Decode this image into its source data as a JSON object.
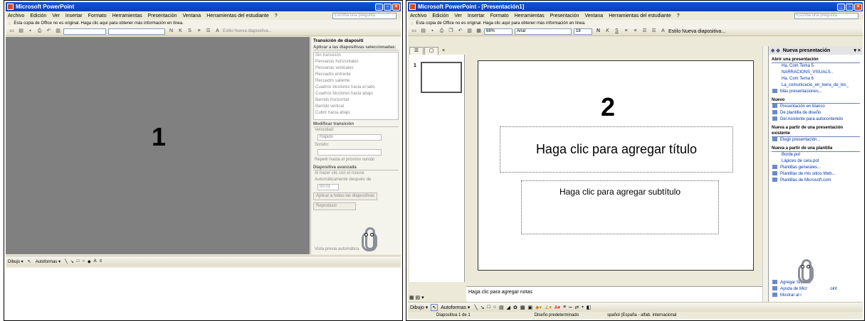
{
  "frame1": {
    "title": "Microsoft PowerPoint",
    "menus": [
      "Archivo",
      "Edición",
      "Ver",
      "Insertar",
      "Formato",
      "Herramientas",
      "Presentación",
      "Ventana",
      "Herramientas del estudiante",
      "?"
    ],
    "ask_placeholder": "Escriba una pregunta",
    "info": "Esta copia de Office no es original.  Haga clic aquí para obtener más información en línea.",
    "toolbar_extra": "Estilo  Nueva diapositiva...",
    "slide_number": "1",
    "pane": {
      "title": "Transición de diapositi",
      "apply_label": "Aplicar a las diapositivas seleccionadas:",
      "transitions": [
        "Sin transición",
        "Persianas horizontales",
        "Persianas verticales",
        "Recuadro entrante",
        "Recuadro saliente",
        "Cuadros bicolores hacia el lado",
        "Cuadros bicolores hacia abajo",
        "Barrido horizontal",
        "Barrido vertical",
        "Cubrir hacia abajo"
      ],
      "modify": "Modificar transición",
      "speed_label": "Velocidad:",
      "speed_value": "Rápido",
      "sound_label": "Sonido:",
      "repeat": "Repetir hasta el próximo sonido",
      "advance": "Diapositiva avanzada",
      "on_click": "Al hacer clic con el mouse",
      "auto": "Automáticamente después de",
      "time": "00:01",
      "apply_all": "Aplicar a todas las diapositivas",
      "play": "Reproducir",
      "preview": "Vista previa automática"
    },
    "draw": {
      "dibujo": "Dibujo ▾",
      "autoformas": "Autoformas ▾"
    }
  },
  "frame2": {
    "title": "Microsoft PowerPoint - [Presentación1]",
    "menus": [
      "Archivo",
      "Edición",
      "Ver",
      "Insertar",
      "Formato",
      "Herramientas",
      "Presentación",
      "Ventana",
      "Herramientas del estudiante",
      "?"
    ],
    "ask_placeholder": "Escriba una pregunta",
    "info": "Esta copia de Office no es original.  Haga clic aquí para obtener más información en línea.",
    "zoom": "68%",
    "font": "Arial",
    "size": "18",
    "toolbar_extra": "Estilo  Nueva diapositiva...",
    "thumb_number": "1",
    "slide_number": "2",
    "title_placeholder": "Haga clic para agregar título",
    "subtitle_placeholder": "Haga clic para agregar subtítulo",
    "notes": "Haga clic para agregar notas",
    "pane": {
      "title": "Nueva presentación",
      "open_section": "Abrir una presentación",
      "recent": [
        "Ha. Com Tema 5",
        "NARRACIONS_VISUALS..",
        "Ha. Com Tema 6",
        "La_comunicacio_en_lxera_de_les_"
      ],
      "more": "Más presentaciones...",
      "new_section": "Nuevo",
      "new_items": [
        "Presentación en blanco",
        "De plantilla de diseño",
        "Del Asistente para autocontenido"
      ],
      "existing_section": "Nueva a partir de una presentación existente",
      "choose": "Elegir presentación...",
      "template_section": "Nueva a partir de una plantilla",
      "templates": [
        "Borde.pot",
        "Lápices de cera.pot"
      ],
      "template_links": [
        "Plantillas generales...",
        "Plantillas de mis sitios Web...",
        "Plantillas de Microsoft.com"
      ],
      "footer": [
        "Agregar Sitio de",
        "Ayuda de Micr",
        "Mostrar al i"
      ],
      "footer_suffix": "oint"
    },
    "draw": {
      "dibujo": "Dibujo ▾",
      "autoformas": "Autoformas ▾"
    },
    "status": {
      "slide": "Diapositiva 1 de 1",
      "design": "Diseño predeterminado",
      "lang": "spañol (España - alfab. internacional"
    }
  }
}
